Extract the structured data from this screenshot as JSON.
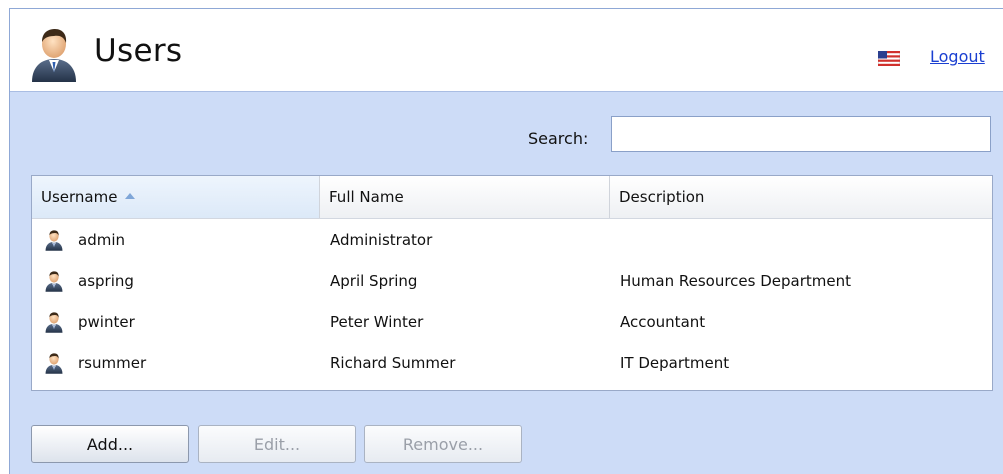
{
  "header": {
    "title": "Users",
    "title_icon": "user-icon",
    "language_icon": "us-flag-icon",
    "logout_label": "Logout"
  },
  "search": {
    "label": "Search:",
    "value": "",
    "placeholder": ""
  },
  "table": {
    "columns": [
      "Username",
      "Full Name",
      "Description"
    ],
    "sorted_column": "Username",
    "sort_direction": "ascending",
    "rows": [
      {
        "username": "admin",
        "full_name": "Administrator",
        "description": ""
      },
      {
        "username": "aspring",
        "full_name": "April Spring",
        "description": "Human Resources Department"
      },
      {
        "username": "pwinter",
        "full_name": "Peter Winter",
        "description": "Accountant"
      },
      {
        "username": "rsummer",
        "full_name": "Richard Summer",
        "description": "IT Department"
      }
    ]
  },
  "buttons": {
    "add_label": "Add...",
    "edit_label": "Edit...",
    "remove_label": "Remove..."
  },
  "colors": {
    "panel_bg": "#cddcf7",
    "link": "#1a3fd1"
  }
}
